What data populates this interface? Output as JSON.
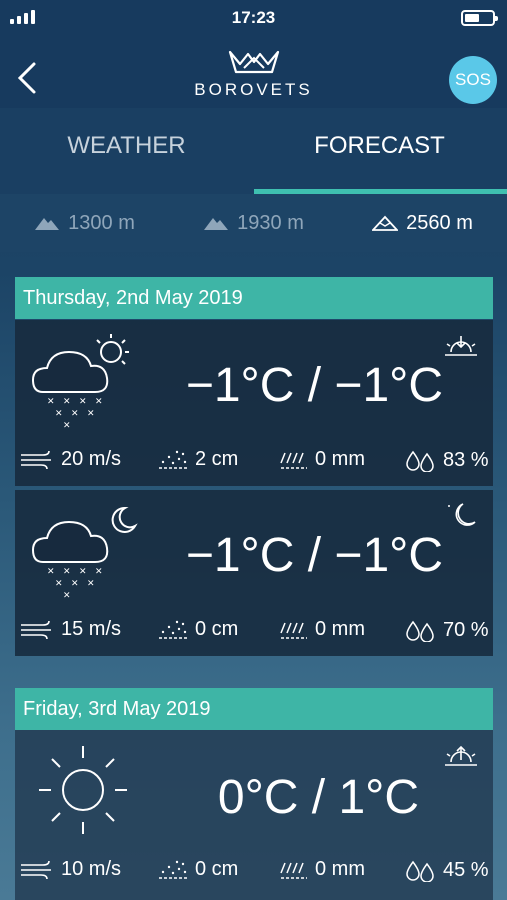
{
  "status_bar": {
    "time": "17:23"
  },
  "header": {
    "logo_text": "BOROVETS",
    "sos_label": "SOS"
  },
  "tabs": [
    {
      "label": "WEATHER"
    },
    {
      "label": "FORECAST"
    }
  ],
  "altitudes": [
    {
      "label": "1300 m"
    },
    {
      "label": "1930 m"
    },
    {
      "label": "2560 m"
    }
  ],
  "days": [
    {
      "date": "Thursday, 2nd May 2019",
      "periods": [
        {
          "icon": "cloud-sun-snow-icon",
          "corner_icon": "sunset-icon",
          "temp": "−1°C / −1°C",
          "wind": "20 m/s",
          "snow": "2 cm",
          "rain": "0 mm",
          "humidity": "83 %"
        },
        {
          "icon": "cloud-moon-snow-icon",
          "corner_icon": "moon-icon",
          "temp": "−1°C / −1°C",
          "wind": "15 m/s",
          "snow": "0 cm",
          "rain": "0 mm",
          "humidity": "70 %"
        }
      ]
    },
    {
      "date": "Friday, 3rd May 2019",
      "periods": [
        {
          "icon": "sun-icon",
          "corner_icon": "sunrise-icon",
          "temp": "0°C / 1°C",
          "wind": "10 m/s",
          "snow": "0 cm",
          "rain": "0 mm",
          "humidity": "45 %"
        }
      ]
    }
  ]
}
